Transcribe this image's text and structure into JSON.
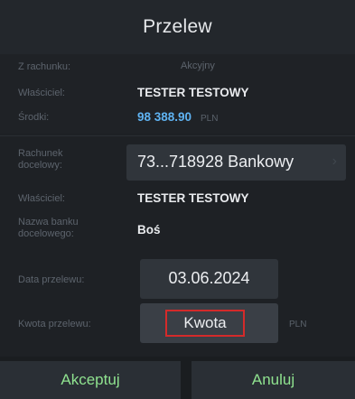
{
  "header": {
    "title": "Przelew"
  },
  "source": {
    "account_label": "Z rachunku:",
    "account_value": "Akcyjny",
    "owner_label": "Właściciel:",
    "owner_value": "TESTER TESTOWY",
    "funds_label": "Środki:",
    "funds_amount": "98 388.90",
    "funds_currency": "PLN"
  },
  "destination": {
    "account_label": "Rachunek docelowy:",
    "account_value": "73...718928 Bankowy",
    "owner_label": "Właściciel:",
    "owner_value": "TESTER TESTOWY",
    "bank_label": "Nazwa banku docelowego:",
    "bank_value": "Boś"
  },
  "transfer": {
    "date_label": "Data przelewu:",
    "date_value": "03.06.2024",
    "amount_label": "Kwota przelewu:",
    "amount_placeholder": "Kwota",
    "amount_currency": "PLN"
  },
  "actions": {
    "accept_label": "Akceptuj",
    "cancel_label": "Anuluj"
  },
  "colors": {
    "background": "#1e2125",
    "panel": "#30353b",
    "accent_green": "#8fe28f",
    "highlight_red": "#d42a2a",
    "funds_blue": "#5fb3f2"
  },
  "icons": {
    "destination_chevron": "chevron-right-icon"
  }
}
